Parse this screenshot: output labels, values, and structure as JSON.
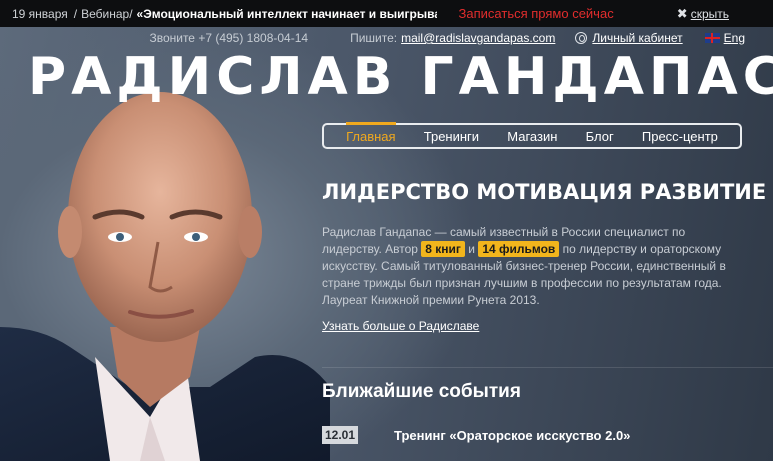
{
  "announcement": {
    "date": "19 января",
    "separator": "/",
    "type": "Вебинар/",
    "title": "«Эмоциональный интеллект начинает и выигрыва",
    "signup": "Записаться прямо сейчас",
    "hide_icon": "close-icon",
    "hide_label": "скрыть"
  },
  "contacts": {
    "phone": "Звоните +7 (495) 1808-04-14",
    "write_label": "Пишите:",
    "email": "mail@radislavgandapas.com",
    "cabinet": "Личный кабинет",
    "language": "Eng"
  },
  "brand": "РАДИСЛАВ ГАНДАПАС",
  "nav": {
    "items": [
      "Главная",
      "Тренинги",
      "Магазин",
      "Блог",
      "Пресс-центр"
    ],
    "active_index": 0
  },
  "headline": "ЛИДЕРСТВО МОТИВАЦИЯ РАЗВИТИЕ",
  "lead": {
    "part1": "Радислав Гандапас — самый известный в России специалист по лидерству. Автор",
    "badge1": "8 книг",
    "part2": "и",
    "badge2": "14 фильмов",
    "part3": "по лидерству и ораторскому искусству. Самый титулованный бизнес-тренер России, единственный в стране трижды был признан лучшим в профессии по результатам года. Лауреат Книжной премии Рунета 2013."
  },
  "more_link": "Узнать больше о Радиславе",
  "events": {
    "title": "Ближайшие события",
    "items": [
      {
        "date": "12.01",
        "name": "Тренинг «Ораторское исскуство 2.0»"
      }
    ]
  },
  "colors": {
    "accent": "#f0a91e",
    "signup": "#e12d2d",
    "badge": "#f2b51c"
  }
}
